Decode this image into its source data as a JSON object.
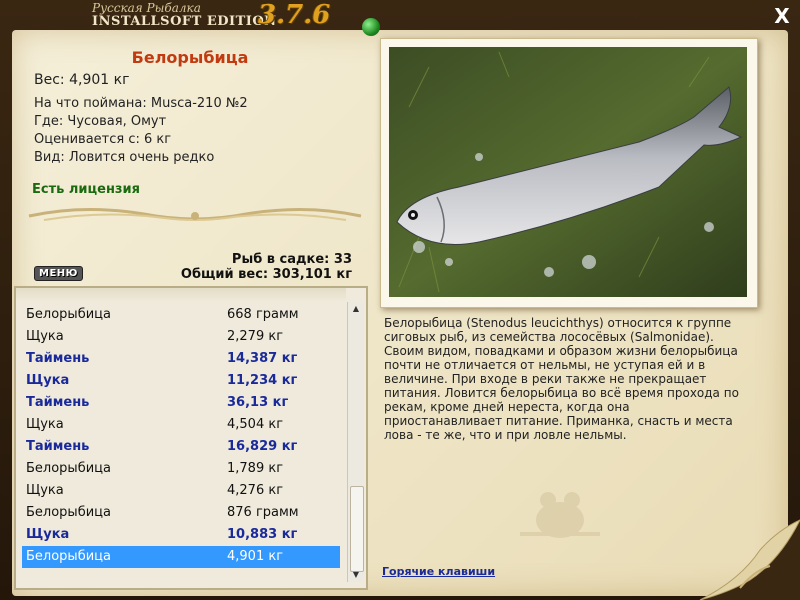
{
  "header": {
    "brand_line1": "Русская Рыбалка",
    "brand_line2": "INSTALLSOFT EDITION",
    "version": "3.7.6",
    "close_label": "X"
  },
  "fish": {
    "title": "Белорыбица",
    "weight": "Вес: 4,901 кг",
    "bait": "На что поймана: Musca-210 №2",
    "place": "Где: Чусовая, Омут",
    "valued": "Оценивается с: 6 кг",
    "kind": "Вид: Ловится очень редко",
    "license": "Есть лицензия"
  },
  "stats": {
    "in_cage": "Рыб в садке: 33",
    "total": "Общий вес: 303,101 кг"
  },
  "menu_label": "МЕНЮ",
  "catches": [
    {
      "name": "Белорыбица",
      "weight": "668 грамм",
      "bold": false,
      "selected": false
    },
    {
      "name": "Щука",
      "weight": "2,279 кг",
      "bold": false,
      "selected": false
    },
    {
      "name": "Таймень",
      "weight": "14,387 кг",
      "bold": true,
      "selected": false
    },
    {
      "name": "Щука",
      "weight": "11,234 кг",
      "bold": true,
      "selected": false
    },
    {
      "name": "Таймень",
      "weight": "36,13 кг",
      "bold": true,
      "selected": false
    },
    {
      "name": "Щука",
      "weight": "4,504 кг",
      "bold": false,
      "selected": false
    },
    {
      "name": "Таймень",
      "weight": "16,829 кг",
      "bold": true,
      "selected": false
    },
    {
      "name": "Белорыбица",
      "weight": "1,789 кг",
      "bold": false,
      "selected": false
    },
    {
      "name": "Щука",
      "weight": "4,276 кг",
      "bold": false,
      "selected": false
    },
    {
      "name": "Белорыбица",
      "weight": "876 грамм",
      "bold": false,
      "selected": false
    },
    {
      "name": "Щука",
      "weight": "10,883 кг",
      "bold": true,
      "selected": false
    },
    {
      "name": "Белорыбица",
      "weight": "4,901 кг",
      "bold": false,
      "selected": true
    }
  ],
  "description": "Белорыбица (Stenodus leucichthys) относится к группе сиговых рыб, из семейства лососёвых (Salmonidae). Своим видом, повадками и образом жизни белорыбица почти не отличается от нельмы, не уступая ей и в величине. При входе в реки также не прекращает питания. Ловится белорыбица во всё время прохода по рекам, кроме дней нереста, когда она приостанавливает питание. Приманка, снасть и места лова - те же, что и при ловле нельмы.",
  "hotkeys_label": "Горячие клавиши",
  "colors": {
    "title": "#c23a10",
    "license": "#1a6a10",
    "bold_row": "#1a2a9a",
    "selected_row": "#3399ff"
  },
  "icons": [
    "close-icon",
    "pin-icon",
    "scroll-up-icon",
    "scroll-down-icon",
    "bear-watermark-icon"
  ]
}
